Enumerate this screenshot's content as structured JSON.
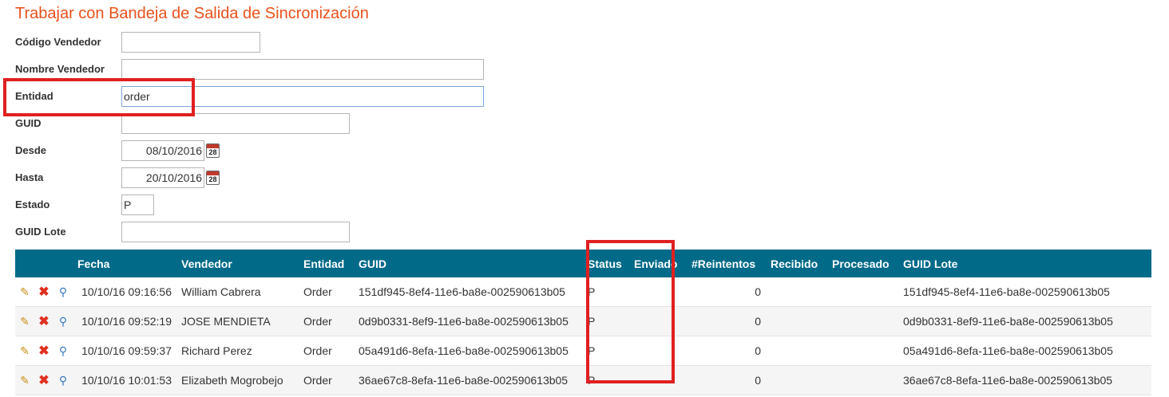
{
  "page": {
    "title": "Trabajar con Bandeja de Salida de Sincronización"
  },
  "form": {
    "codigo_vendedor": {
      "label": "Código Vendedor",
      "value": ""
    },
    "nombre_vendedor": {
      "label": "Nombre Vendedor",
      "value": ""
    },
    "entidad": {
      "label": "Entidad",
      "value": "order"
    },
    "guid": {
      "label": "GUID",
      "value": ""
    },
    "desde": {
      "label": "Desde",
      "value": "08/10/2016",
      "calendar_day": "28"
    },
    "hasta": {
      "label": "Hasta",
      "value": "20/10/2016",
      "calendar_day": "28"
    },
    "estado": {
      "label": "Estado",
      "value": "P"
    },
    "guid_lote": {
      "label": "GUID Lote",
      "value": ""
    }
  },
  "table": {
    "headers": [
      "Fecha",
      "Vendedor",
      "Entidad",
      "GUID",
      "Status",
      "Enviado",
      "#Reintentos",
      "Recibido",
      "Procesado",
      "GUID Lote"
    ],
    "rows": [
      {
        "fecha": "10/10/16 09:16:56",
        "vendedor": "William Cabrera",
        "entidad": "Order",
        "guid": "151df945-8ef4-11e6-ba8e-002590613b05",
        "status": "P",
        "enviado": "",
        "reintentos": "0",
        "recibido": "",
        "procesado": "",
        "guid_lote": "151df945-8ef4-11e6-ba8e-002590613b05"
      },
      {
        "fecha": "10/10/16 09:52:19",
        "vendedor": "JOSE MENDIETA",
        "entidad": "Order",
        "guid": "0d9b0331-8ef9-11e6-ba8e-002590613b05",
        "status": "P",
        "enviado": "",
        "reintentos": "0",
        "recibido": "",
        "procesado": "",
        "guid_lote": "0d9b0331-8ef9-11e6-ba8e-002590613b05"
      },
      {
        "fecha": "10/10/16 09:59:37",
        "vendedor": "Richard Perez",
        "entidad": "Order",
        "guid": "05a491d6-8efa-11e6-ba8e-002590613b05",
        "status": "P",
        "enviado": "",
        "reintentos": "0",
        "recibido": "",
        "procesado": "",
        "guid_lote": "05a491d6-8efa-11e6-ba8e-002590613b05"
      },
      {
        "fecha": "10/10/16 10:01:53",
        "vendedor": "Elizabeth Mogrobejo",
        "entidad": "Order",
        "guid": "36ae67c8-8efa-11e6-ba8e-002590613b05",
        "status": "P",
        "enviado": "",
        "reintentos": "0",
        "recibido": "",
        "procesado": "",
        "guid_lote": "36ae67c8-8efa-11e6-ba8e-002590613b05"
      }
    ]
  },
  "icons": {
    "edit": "edit-icon",
    "delete": "delete-icon",
    "view": "magnifier-icon"
  },
  "colors": {
    "title": "#e8521c",
    "header_bg": "#016a89",
    "highlight_box": "#e02020"
  }
}
